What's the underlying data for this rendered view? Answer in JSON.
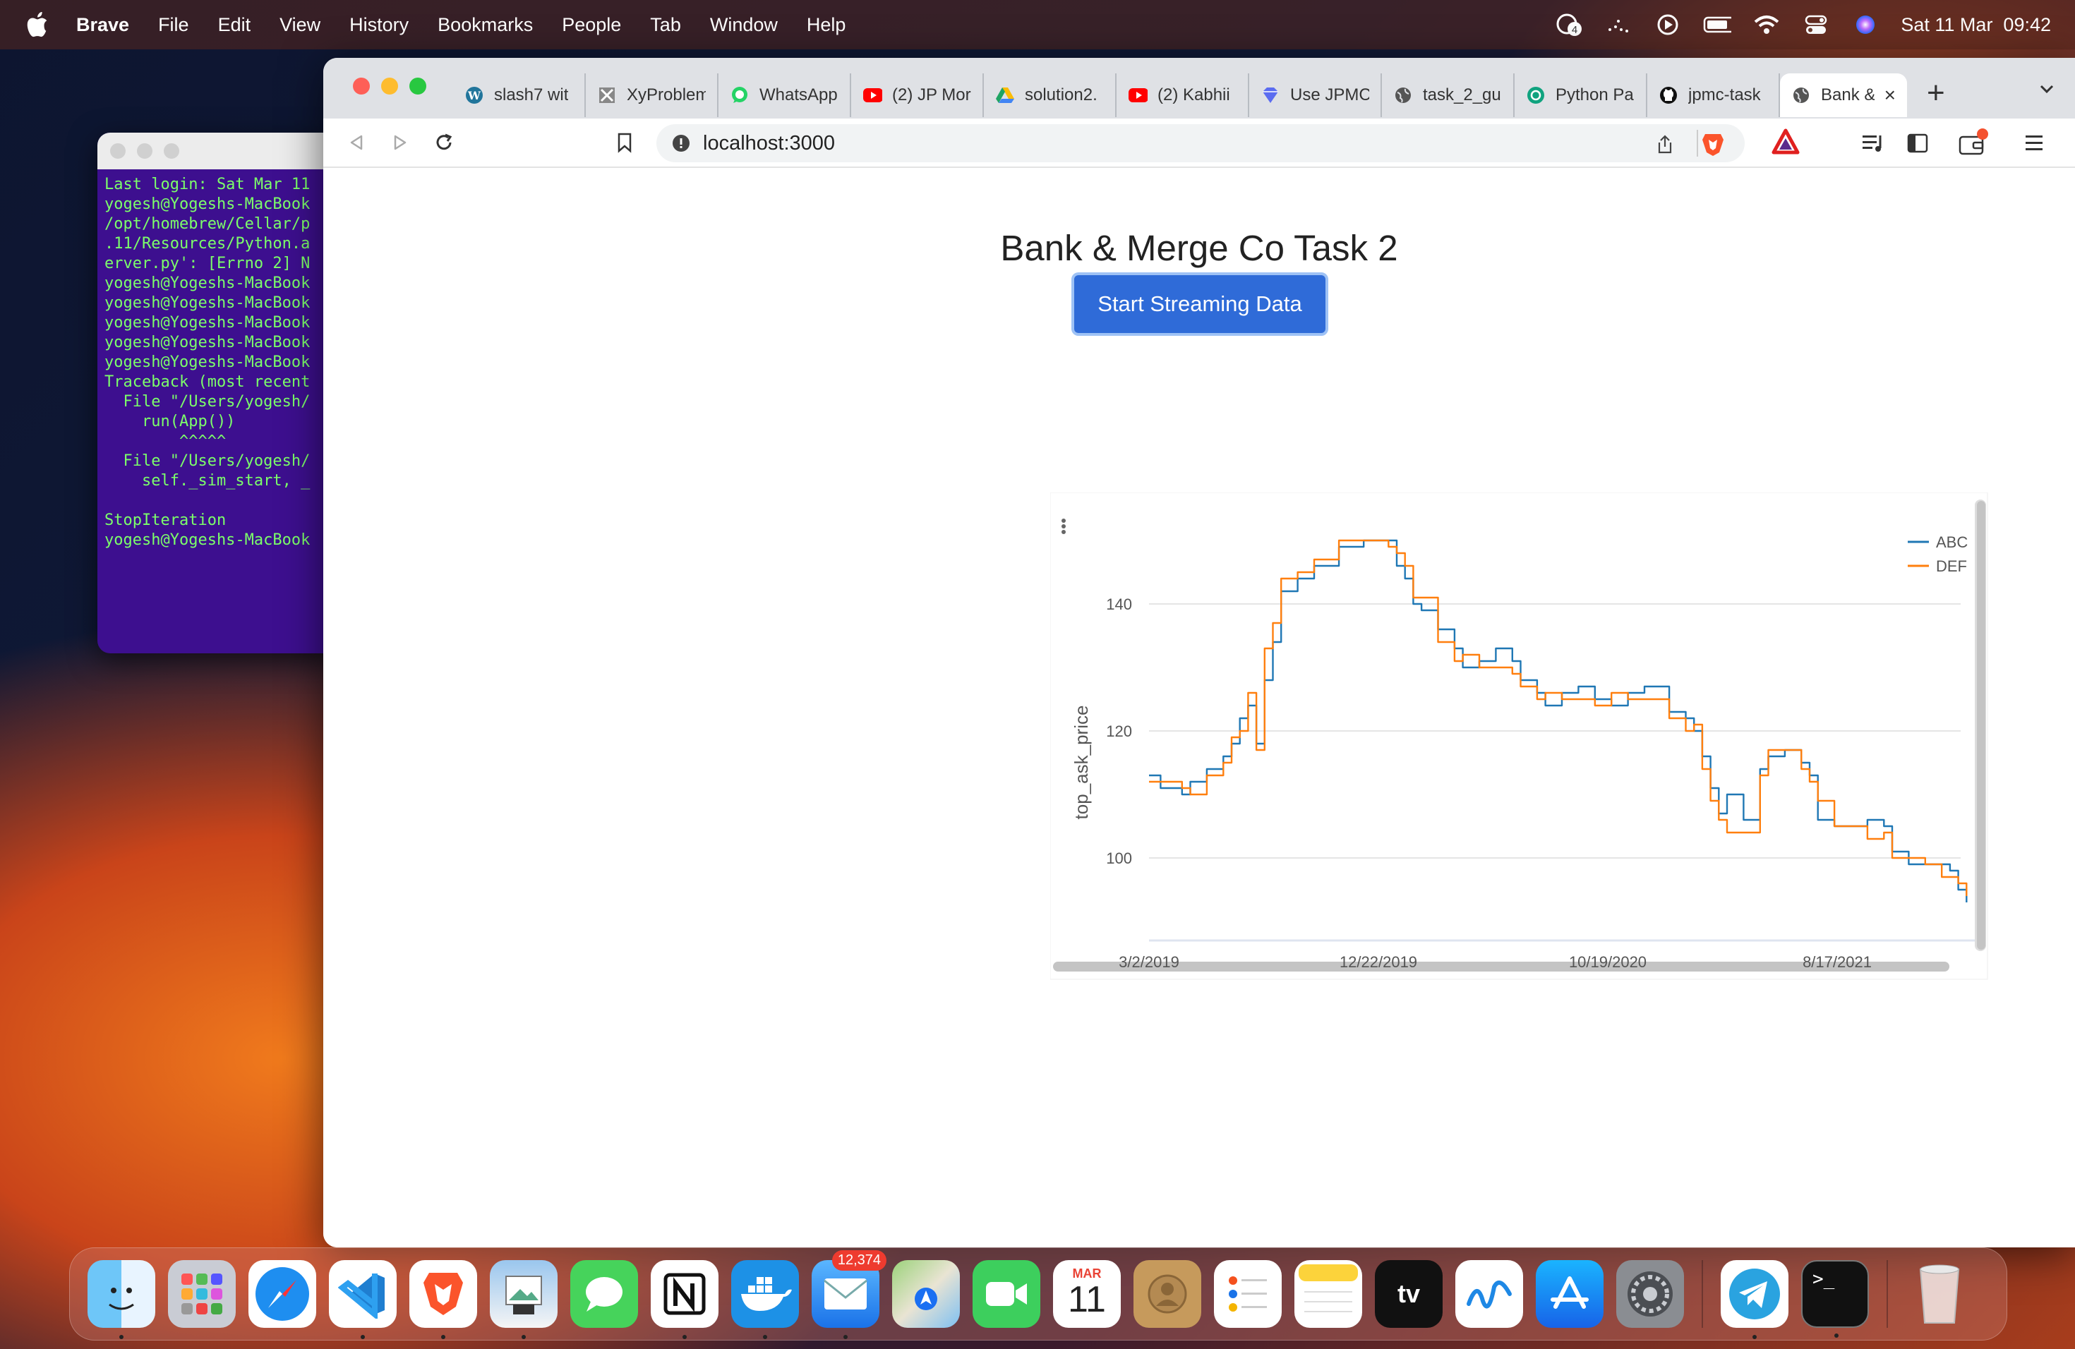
{
  "menubar": {
    "app_name": "Brave",
    "items": [
      "File",
      "Edit",
      "View",
      "History",
      "Bookmarks",
      "People",
      "Tab",
      "Window",
      "Help"
    ],
    "status_icons": [
      "notification-icon",
      "dots-icon",
      "play-icon",
      "battery-icon",
      "wifi-icon",
      "control-center-icon",
      "siri-icon"
    ],
    "notification_count": "4",
    "clock": "Sat 11 Mar  09:42"
  },
  "terminal": {
    "lines": [
      "Last login: Sat Mar 11",
      "yogesh@Yogeshs-MacBook",
      "/opt/homebrew/Cellar/p",
      ".11/Resources/Python.a",
      "erver.py': [Errno 2] N",
      "yogesh@Yogeshs-MacBook",
      "yogesh@Yogeshs-MacBook",
      "yogesh@Yogeshs-MacBook",
      "yogesh@Yogeshs-MacBook",
      "yogesh@Yogeshs-MacBook",
      "Traceback (most recent",
      "  File \"/Users/yogesh/",
      "    run(App())",
      "        ^^^^^",
      "  File \"/Users/yogesh/",
      "    self._sim_start, _",
      "",
      "StopIteration",
      "yogesh@Yogeshs-MacBook"
    ]
  },
  "browser": {
    "tabs": [
      {
        "label": "slash7 wit",
        "icon": "wordpress-icon"
      },
      {
        "label": "XyProblem",
        "icon": "xy-icon"
      },
      {
        "label": "WhatsApp",
        "icon": "whatsapp-icon"
      },
      {
        "label": "(2) JP Mor",
        "icon": "youtube-icon"
      },
      {
        "label": "solution2.",
        "icon": "google-drive-icon"
      },
      {
        "label": "(2) Kabhii",
        "icon": "youtube-icon"
      },
      {
        "label": "Use JPMC",
        "icon": "gem-icon"
      },
      {
        "label": "task_2_gu",
        "icon": "globe-icon"
      },
      {
        "label": "Python Pa",
        "icon": "openai-icon"
      },
      {
        "label": "jpmc-task",
        "icon": "github-icon"
      },
      {
        "label": "Bank &",
        "icon": "globe-icon",
        "active": true
      }
    ],
    "address": "localhost:3000"
  },
  "page": {
    "title": "Bank & Merge Co Task 2",
    "button_label": "Start Streaming Data"
  },
  "chart_data": {
    "type": "line",
    "ylabel": "top_ask_price",
    "x_ticks": [
      "3/2/2019",
      "12/22/2019",
      "10/19/2020",
      "8/17/2021"
    ],
    "y_ticks": [
      100,
      120,
      140
    ],
    "ylim": [
      87,
      152
    ],
    "legend": "top-right",
    "grid": true,
    "series": [
      {
        "name": "ABC",
        "color": "#1f77b4",
        "points": [
          [
            0,
            113
          ],
          [
            1.4,
            111
          ],
          [
            4,
            110
          ],
          [
            5,
            112
          ],
          [
            7,
            114
          ],
          [
            9,
            116
          ],
          [
            10,
            118
          ],
          [
            11,
            122
          ],
          [
            12,
            124
          ],
          [
            13,
            118
          ],
          [
            14,
            128
          ],
          [
            15,
            134
          ],
          [
            16,
            142
          ],
          [
            18,
            144
          ],
          [
            20,
            146
          ],
          [
            23,
            149
          ],
          [
            26,
            150
          ],
          [
            29,
            150
          ],
          [
            30,
            146
          ],
          [
            31,
            144
          ],
          [
            32,
            140
          ],
          [
            33,
            139
          ],
          [
            35,
            136
          ],
          [
            37,
            133
          ],
          [
            38,
            130
          ],
          [
            40,
            131
          ],
          [
            42,
            133
          ],
          [
            44,
            131
          ],
          [
            45,
            128
          ],
          [
            47,
            126
          ],
          [
            48,
            124
          ],
          [
            50,
            126
          ],
          [
            52,
            127
          ],
          [
            54,
            125
          ],
          [
            56,
            124
          ],
          [
            58,
            126
          ],
          [
            60,
            127
          ],
          [
            62,
            127
          ],
          [
            63,
            123
          ],
          [
            65,
            122
          ],
          [
            66,
            120
          ],
          [
            67,
            116
          ],
          [
            68,
            111
          ],
          [
            69,
            107
          ],
          [
            70,
            110
          ],
          [
            72,
            106
          ],
          [
            74,
            114
          ],
          [
            75,
            116
          ],
          [
            77,
            117
          ],
          [
            79,
            115
          ],
          [
            80,
            113
          ],
          [
            81,
            106
          ],
          [
            83,
            105
          ],
          [
            85,
            105
          ],
          [
            87,
            106
          ],
          [
            89,
            105
          ],
          [
            90,
            101
          ],
          [
            92,
            99
          ],
          [
            94,
            99
          ],
          [
            96,
            99
          ],
          [
            97,
            98
          ],
          [
            98,
            95
          ],
          [
            99,
            93
          ]
        ]
      },
      {
        "name": "DEF",
        "color": "#ff7f0e",
        "points": [
          [
            0,
            112
          ],
          [
            1.5,
            112
          ],
          [
            4,
            111
          ],
          [
            5,
            110
          ],
          [
            7,
            113
          ],
          [
            9,
            115
          ],
          [
            10,
            119
          ],
          [
            11,
            120
          ],
          [
            12,
            126
          ],
          [
            13,
            117
          ],
          [
            14,
            133
          ],
          [
            15,
            137
          ],
          [
            16,
            144
          ],
          [
            18,
            145
          ],
          [
            20,
            147
          ],
          [
            23,
            150
          ],
          [
            26,
            150
          ],
          [
            29,
            149
          ],
          [
            30,
            148
          ],
          [
            31,
            146
          ],
          [
            32,
            141
          ],
          [
            33,
            141
          ],
          [
            35,
            134
          ],
          [
            37,
            131
          ],
          [
            38,
            132
          ],
          [
            40,
            130
          ],
          [
            42,
            130
          ],
          [
            44,
            129
          ],
          [
            45,
            127
          ],
          [
            47,
            125
          ],
          [
            48,
            126
          ],
          [
            50,
            125
          ],
          [
            52,
            125
          ],
          [
            54,
            124
          ],
          [
            56,
            126
          ],
          [
            58,
            125
          ],
          [
            60,
            125
          ],
          [
            62,
            125
          ],
          [
            63,
            122
          ],
          [
            65,
            120
          ],
          [
            66,
            121
          ],
          [
            67,
            114
          ],
          [
            68,
            109
          ],
          [
            69,
            106
          ],
          [
            70,
            104
          ],
          [
            72,
            104
          ],
          [
            74,
            113
          ],
          [
            75,
            117
          ],
          [
            77,
            117
          ],
          [
            79,
            114
          ],
          [
            80,
            112
          ],
          [
            81,
            109
          ],
          [
            83,
            105
          ],
          [
            85,
            105
          ],
          [
            87,
            103
          ],
          [
            89,
            104
          ],
          [
            90,
            100
          ],
          [
            92,
            100
          ],
          [
            94,
            99
          ],
          [
            96,
            97
          ],
          [
            97,
            97
          ],
          [
            98,
            96
          ],
          [
            99,
            94
          ]
        ]
      }
    ]
  },
  "dock": {
    "mail_badge": "12,374",
    "calendar_month": "MAR",
    "calendar_day": "11",
    "apps": [
      "finder",
      "launchpad",
      "safari",
      "vscode",
      "brave",
      "preview",
      "messages",
      "notion",
      "docker",
      "mail",
      "maps",
      "facetime",
      "calendar",
      "contacts",
      "reminders",
      "notes",
      "tv",
      "freeform",
      "app-store",
      "system-settings",
      "telegram",
      "terminal",
      "trash"
    ]
  }
}
